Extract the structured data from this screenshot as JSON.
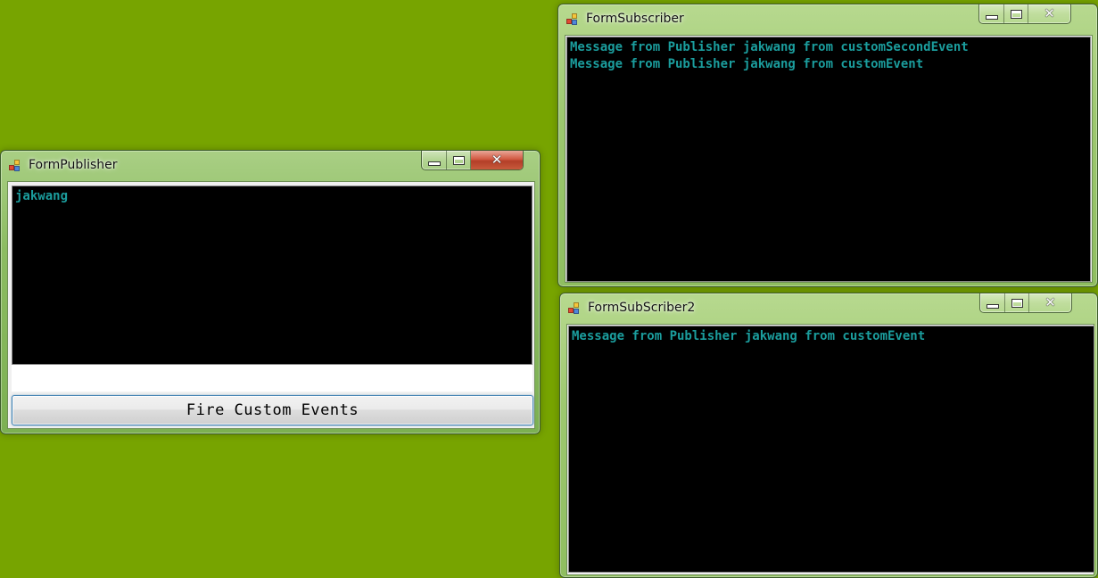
{
  "publisher": {
    "title": "FormPublisher",
    "console_lines": [
      "jakwang"
    ],
    "button_label": "Fire Custom Events"
  },
  "subscriber": {
    "title": "FormSubscriber",
    "console_lines": [
      "Message from Publisher jakwang from customSecondEvent",
      "Message from Publisher jakwang from customEvent"
    ]
  },
  "subscriber2": {
    "title": "FormSubScriber2",
    "console_lines": [
      "Message from Publisher jakwang from customEvent"
    ]
  },
  "colors": {
    "desktop": "#77a400",
    "console_text": "#1b9d9d",
    "console_bg": "#000000",
    "close_active": "#c8452d"
  },
  "icons": {
    "app": "winforms-app-icon",
    "minimize": "minimize-icon",
    "maximize": "maximize-icon",
    "close": "close-icon"
  }
}
